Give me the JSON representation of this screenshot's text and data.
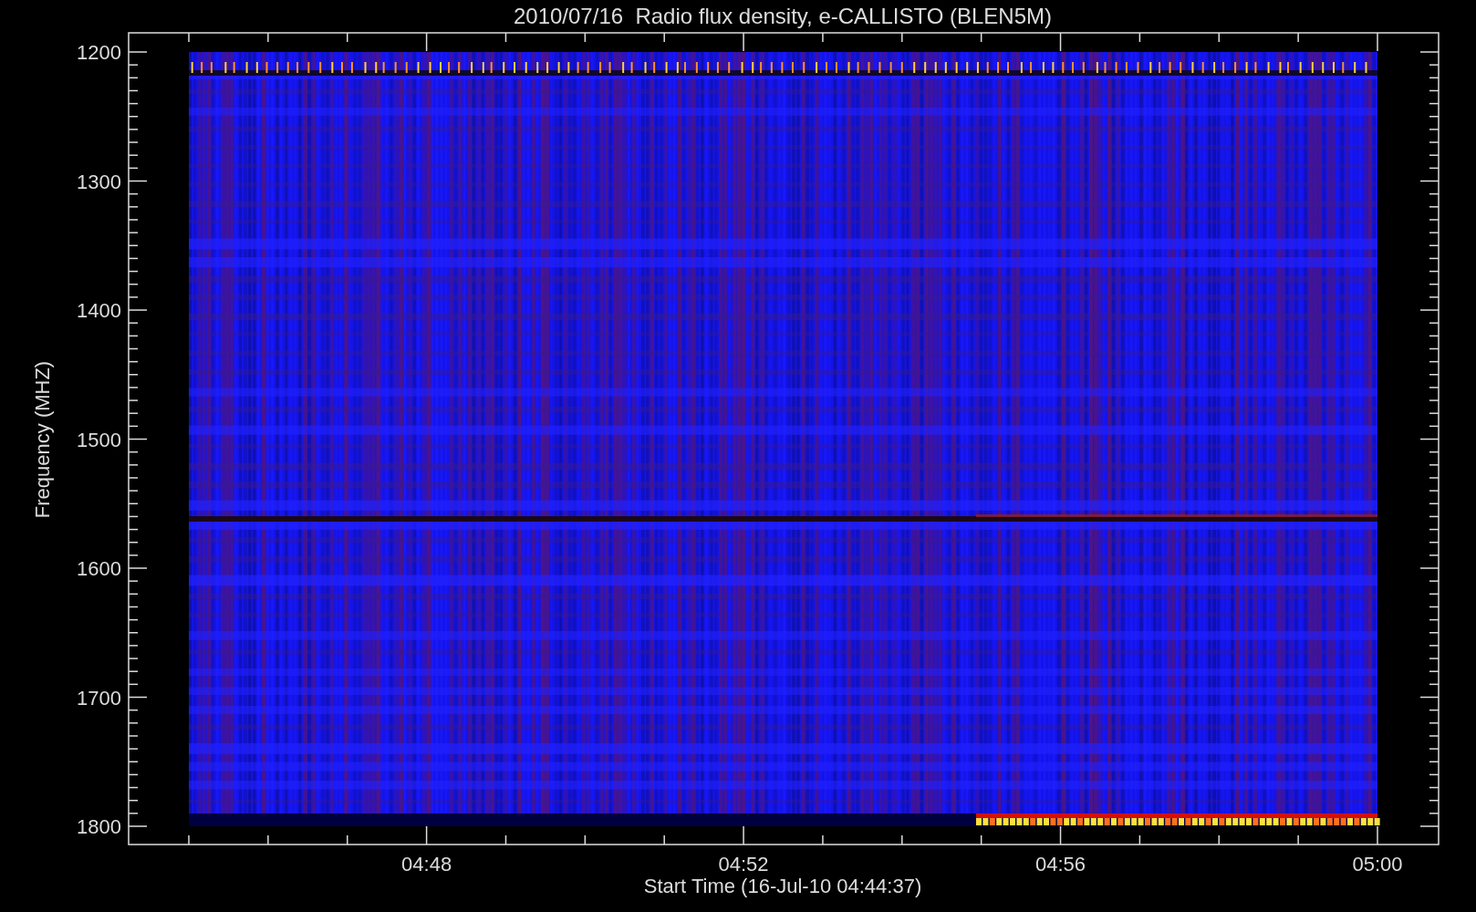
{
  "title": "2010/07/16  Radio flux density, e-CALLISTO (BLEN5M)",
  "y_axis": {
    "label": "Frequency (MHZ)",
    "ticks": [
      "1200",
      "1300",
      "1400",
      "1500",
      "1600",
      "1700",
      "1800"
    ]
  },
  "x_axis": {
    "label": "Start Time (16-Jul-10 04:44:37)",
    "ticks": [
      "04:48",
      "04:52",
      "04:56",
      "05:00"
    ]
  }
}
